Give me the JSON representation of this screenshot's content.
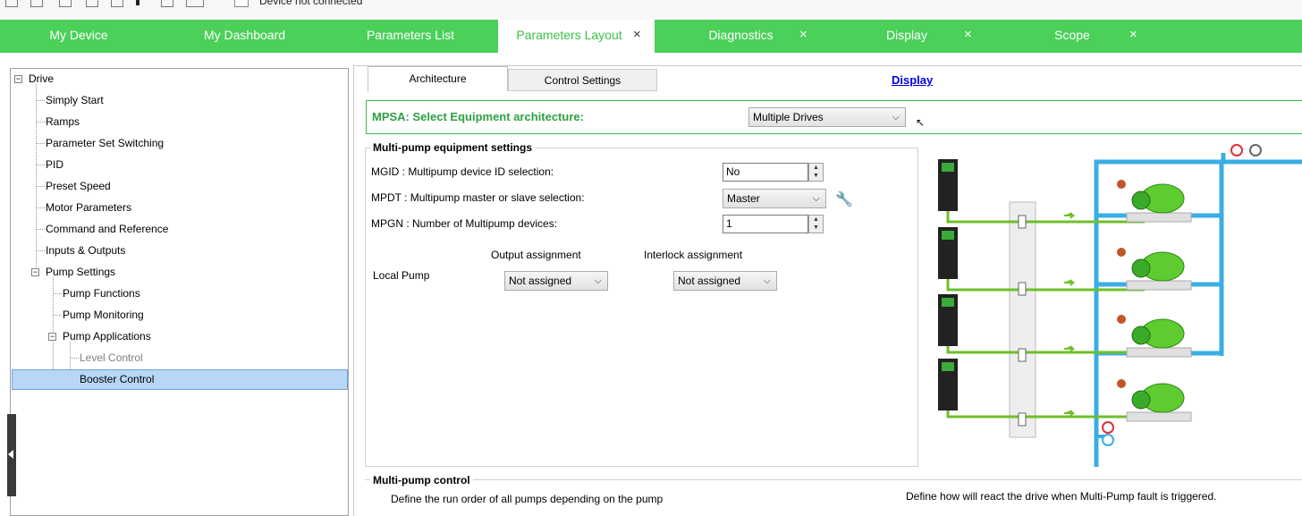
{
  "topbar": {
    "connection_status": "Device not connected"
  },
  "tabs": [
    {
      "label": "My Device"
    },
    {
      "label": "My Dashboard"
    },
    {
      "label": "Parameters List"
    },
    {
      "label": "Parameters Layout"
    },
    {
      "label": "Diagnostics"
    },
    {
      "label": "Display"
    },
    {
      "label": "Scope"
    }
  ],
  "close_glyph": "×",
  "tree": {
    "items": [
      {
        "label": "Drive"
      },
      {
        "label": "Simply Start"
      },
      {
        "label": "Ramps"
      },
      {
        "label": "Parameter Set Switching"
      },
      {
        "label": "PID"
      },
      {
        "label": "Preset Speed"
      },
      {
        "label": "Motor Parameters"
      },
      {
        "label": "Command and Reference"
      },
      {
        "label": "Inputs & Outputs"
      },
      {
        "label": "Pump Settings"
      },
      {
        "label": "Pump Functions"
      },
      {
        "label": "Pump Monitoring"
      },
      {
        "label": "Pump Applications"
      },
      {
        "label": "Level Control"
      },
      {
        "label": "Booster Control"
      }
    ],
    "collapse_glyph": "−"
  },
  "subtabs": {
    "architecture": "Architecture",
    "control_settings": "Control Settings"
  },
  "display_link": "Display",
  "mpsa": {
    "label": "MPSA: Select Equipment architecture:",
    "value": "Multiple Drives"
  },
  "multipump_settings": {
    "title": "Multi-pump equipment settings",
    "mgid_label": "MGID : Multipump device ID selection:",
    "mgid_value": "No",
    "mpdt_label": "MPDT : Multipump master or slave selection:",
    "mpdt_value": "Master",
    "mpgn_label": "MPGN : Number of Multipump devices:",
    "mpgn_value": "1",
    "output_assignment_header": "Output assignment",
    "interlock_assignment_header": "Interlock assignment",
    "local_pump_label": "Local Pump",
    "output_assignment_value": "Not assigned",
    "interlock_assignment_value": "Not assigned"
  },
  "multipump_control": {
    "title": "Multi-pump control",
    "run_order_text": "Define the run order of all pumps depending on the pump",
    "fault_text": "Define how will react the drive when Multi-Pump fault is triggered."
  },
  "glyphs": {
    "chevron": "⌵",
    "spin_up": "▲",
    "spin_down": "▼",
    "wrench": "🔧",
    "cursor": "↖"
  },
  "colors": {
    "tab_green": "#4bd05a",
    "label_green": "#2ea043",
    "pipe_blue": "#3aaee4",
    "wire_green": "#6fbf2a",
    "pump_green": "#5ecb2f"
  }
}
